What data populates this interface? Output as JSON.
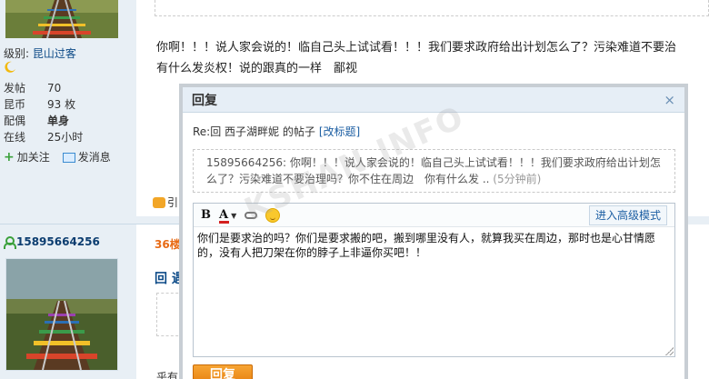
{
  "post1": {
    "author_level_label": "级别:",
    "author_level_value": "昆山过客",
    "stats": [
      {
        "key": "发帖",
        "value": "70"
      },
      {
        "key": "昆币",
        "value": "93 枚"
      },
      {
        "key": "配偶",
        "value": "单身"
      },
      {
        "key": "在线",
        "value": "25小时"
      }
    ],
    "follow_label": "加关注",
    "message_label": "发消息",
    "text_line1": "你啊！！！说人家会说的！临自己头上试试看！！！我们要求政府给出计划怎么了？污染难道不要治",
    "text_line2": "有什么发炎权！说的跟真的一样　鄙视",
    "reply_fragment": "引"
  },
  "post2": {
    "username": "15895664256",
    "floor": "36楼",
    "title_fragment": "回 遇",
    "text_fragment": "乎有"
  },
  "dialog": {
    "title": "回复",
    "close_icon": "×",
    "subtitle": "Re:回 西子湖畔妮 的帖子",
    "edit_title_link": "[改标题]",
    "quote_text": "15895664256: 你啊！！！说人家会说的！临自己头上试试看！！！我们要求政府给出计划怎么了？污染难道不要治理吗？你不住在周边　你有什么发 ..",
    "quote_time": "(5分钟前)",
    "toolbar": {
      "bold": "B",
      "color": "A",
      "caret": "▼",
      "advanced_mode": "进入高级模式"
    },
    "editor_text": "你们是要求治的吗？你们是要求搬的吧，搬到哪里没有人，就算我买在周边，那时也是心甘情愿的，没有人把刀架在你的脖子上非逼你买吧！！",
    "submit_label": "回复"
  },
  "watermark": "KSHAN.INFO"
}
